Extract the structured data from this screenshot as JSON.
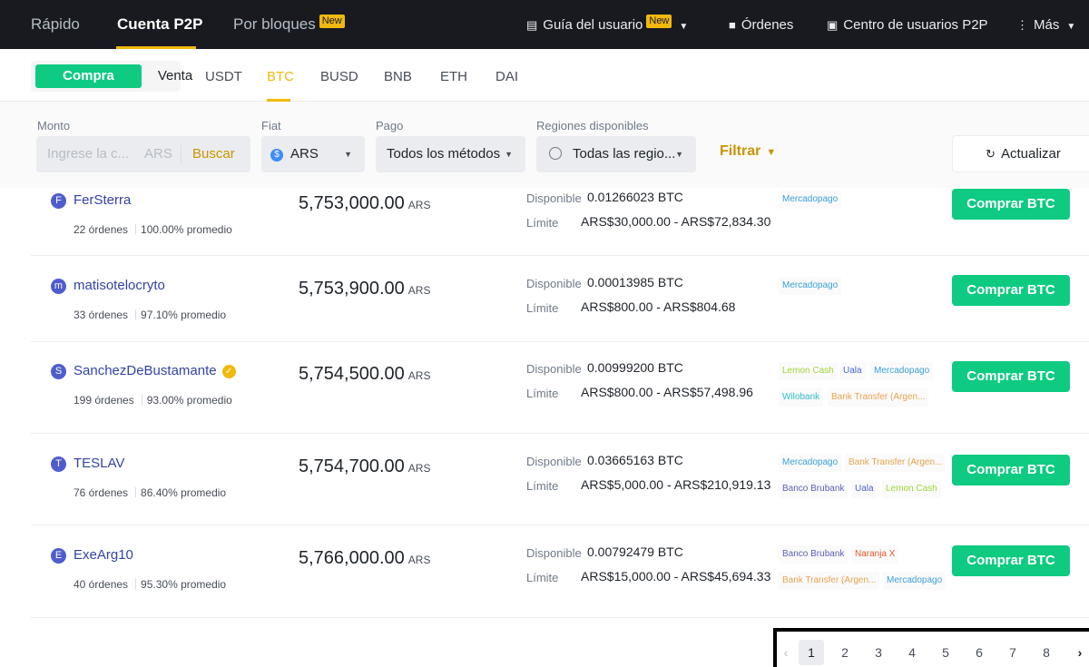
{
  "topnav": {
    "items": [
      "Rápido",
      "Cuenta P2P",
      "Por bloques"
    ],
    "new_badge": "New",
    "guide": "Guía del usuario",
    "orders": "Órdenes",
    "center": "Centro de usuarios P2P",
    "more": "Más"
  },
  "trade": {
    "buy": "Compra",
    "sell": "Venta",
    "coins": [
      "USDT",
      "BTC",
      "BUSD",
      "BNB",
      "ETH",
      "DAI"
    ],
    "active_coin": "BTC"
  },
  "filters": {
    "monto_label": "Monto",
    "monto_placeholder": "Ingrese la c...",
    "monto_currency": "ARS",
    "search": "Buscar",
    "fiat_label": "Fiat",
    "fiat_value": "ARS",
    "pago_label": "Pago",
    "pago_value": "Todos los métodos",
    "regions_label": "Regiones disponibles",
    "regions_value": "Todas las regio...",
    "filter": "Filtrar",
    "refresh": "Actualizar"
  },
  "labels": {
    "available": "Disponible",
    "limit": "Límite",
    "currency": "ARS",
    "buy_button": "Comprar BTC"
  },
  "offers": [
    {
      "initial": "F",
      "name": "FerSterra",
      "verified": false,
      "orders": "22 órdenes",
      "completion": "100.00% promedio",
      "price": "5,753,000.00",
      "available": "0.01266023 BTC",
      "limit": "ARS$30,000.00 - ARS$72,834.30",
      "payments": [
        [
          "Mercadopago",
          "mp"
        ]
      ]
    },
    {
      "initial": "m",
      "name": "matisotelocryto",
      "verified": false,
      "orders": "33 órdenes",
      "completion": "97.10% promedio",
      "price": "5,753,900.00",
      "available": "0.00013985 BTC",
      "limit": "ARS$800.00 - ARS$804.68",
      "payments": [
        [
          "Mercadopago",
          "mp"
        ]
      ]
    },
    {
      "initial": "S",
      "name": "SanchezDeBustamante",
      "verified": true,
      "orders": "199 órdenes",
      "completion": "93.00% promedio",
      "price": "5,754,500.00",
      "available": "0.00999200 BTC",
      "limit": "ARS$800.00 - ARS$57,498.96",
      "payments": [
        [
          "Lemon Cash",
          "lemon"
        ],
        [
          "Uala",
          "uala"
        ],
        [
          "Mercadopago",
          "mp"
        ],
        [
          "Wilobank",
          "wilo"
        ],
        [
          "Bank Transfer (Argen...",
          "bank"
        ]
      ]
    },
    {
      "initial": "T",
      "name": "TESLAV",
      "verified": false,
      "orders": "76 órdenes",
      "completion": "86.40% promedio",
      "price": "5,754,700.00",
      "available": "0.03665163 BTC",
      "limit": "ARS$5,000.00 - ARS$210,919.13",
      "payments": [
        [
          "Mercadopago",
          "mp"
        ],
        [
          "Bank Transfer (Argen...",
          "bank"
        ],
        [
          "Banco Brubank",
          "brubank"
        ],
        [
          "Uala",
          "uala"
        ],
        [
          "Lemon Cash",
          "lemon"
        ]
      ]
    },
    {
      "initial": "E",
      "name": "ExeArg10",
      "verified": false,
      "orders": "40 órdenes",
      "completion": "95.30% promedio",
      "price": "5,766,000.00",
      "available": "0.00792479 BTC",
      "limit": "ARS$15,000.00 - ARS$45,694.33",
      "payments": [
        [
          "Banco Brubank",
          "brubank"
        ],
        [
          "Naranja X",
          "naranja"
        ],
        [
          "Bank Transfer (Argen...",
          "bank"
        ],
        [
          "Mercadopago",
          "mp"
        ]
      ]
    }
  ],
  "pagination": {
    "pages": [
      "1",
      "2",
      "3",
      "4",
      "5",
      "6",
      "7",
      "8"
    ],
    "current": "1"
  }
}
